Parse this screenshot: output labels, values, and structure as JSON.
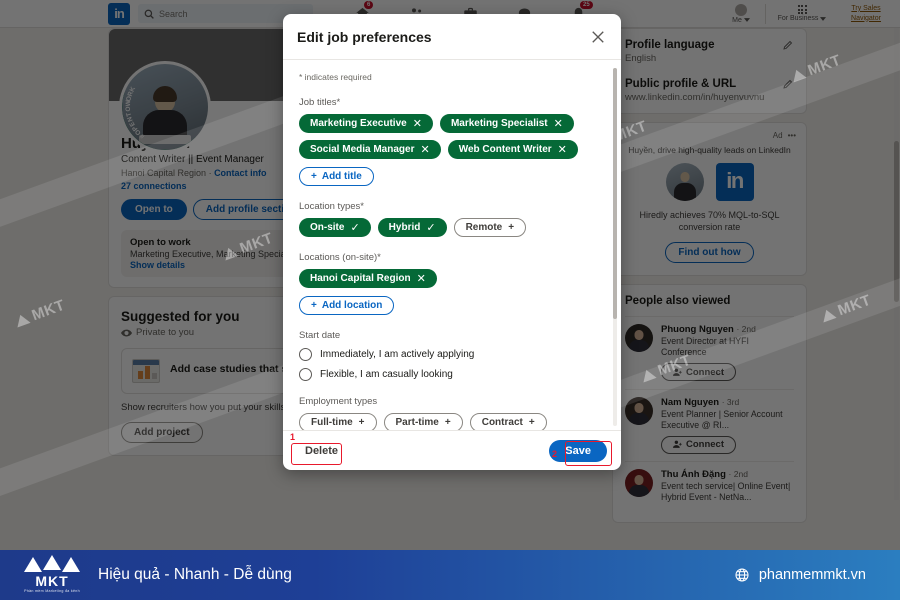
{
  "topnav": {
    "logo_text": "in",
    "search_placeholder": "Search",
    "items": [
      {
        "name": "home",
        "icon": "home-icon",
        "badge": "6"
      },
      {
        "name": "my-network",
        "icon": "people-icon",
        "badge": ""
      },
      {
        "name": "jobs",
        "icon": "briefcase-icon",
        "badge": ""
      },
      {
        "name": "messaging",
        "icon": "message-icon",
        "badge": ""
      },
      {
        "name": "notifications",
        "icon": "bell-icon",
        "badge": "25"
      }
    ],
    "me_label": "Me",
    "business_label": "For Business",
    "sales_nav_line1": "Try Sales",
    "sales_nav_line2": "Navigator"
  },
  "profile": {
    "name": "Huyền Vũ",
    "headline": "Content Writer || Event Manager",
    "location": "Hanoi Capital Region",
    "contact_info": "Contact info",
    "connections": "27 connections",
    "open_to_button": "Open to",
    "add_section_button": "Add profile section",
    "photo_frame_text": "#OPENTOWORK",
    "open_to_work": {
      "title": "Open to work",
      "subtitle": "Marketing Executive, Marketing Special...",
      "link": "Show details"
    }
  },
  "suggested": {
    "title": "Suggested for you",
    "private_label": "Private to you",
    "card_title": "Add case studies that sho",
    "card_desc": "Show recruiters how you put your skills to use by adding projects to your profile.",
    "card_button": "Add project"
  },
  "right_rail": {
    "profile_language": {
      "title": "Profile language",
      "value": "English"
    },
    "public_profile": {
      "title": "Public profile & URL",
      "value": "www.linkedin.com/in/huyenvuvnu"
    },
    "ad": {
      "label": "Ad",
      "more": "•••",
      "headline": "Huyền, drive high-quality leads on LinkedIn",
      "body": "Hiredly achieves 70% MQL-to-SQL conversion rate",
      "button": "Find out how",
      "brand_mark": "in"
    },
    "people_also_viewed": {
      "title": "People also viewed",
      "connect_label": "Connect",
      "people": [
        {
          "name": "Phuong Nguyen",
          "degree": "· 2nd",
          "desc": "Event Director at HYFI Conference",
          "avatar_color": "#2f2a26"
        },
        {
          "name": "Nam Nguyen",
          "degree": "· 3rd",
          "desc": "Event Planner | Senior Account Executive @ RI...",
          "avatar_color": "#3a2f28"
        },
        {
          "name": "Thu Ánh Đặng",
          "degree": "· 2nd",
          "desc": "Event tech service| Online Event| Hybrid Event - NetNa...",
          "avatar_color": "#7a1f22"
        }
      ]
    }
  },
  "modal": {
    "title": "Edit job preferences",
    "close_icon": "close-icon",
    "required_note": "* indicates required",
    "job_titles": {
      "label": "Job titles*",
      "chips": [
        "Marketing Executive",
        "Marketing Specialist",
        "Social Media Manager",
        "Web Content Writer"
      ],
      "add_button": "Add title"
    },
    "location_types": {
      "label": "Location types*",
      "selected": [
        "On-site",
        "Hybrid"
      ],
      "unselected": [
        "Remote"
      ]
    },
    "locations": {
      "label": "Locations (on-site)*",
      "chips": [
        "Hanoi Capital Region"
      ],
      "add_button": "Add location"
    },
    "start_date": {
      "label": "Start date",
      "options": [
        "Immediately, I am actively applying",
        "Flexible, I am casually looking"
      ]
    },
    "employment_types": {
      "label": "Employment types",
      "options": [
        "Full-time",
        "Part-time",
        "Contract"
      ]
    },
    "footer": {
      "delete_label": "Delete",
      "save_label": "Save",
      "delete_step": "1",
      "save_step": "2"
    }
  },
  "watermarks": {
    "text": "MKT",
    "instances": [
      "MKT",
      "MKT",
      "MKT",
      "MKT",
      "MKT",
      "MKT",
      "MKT"
    ]
  },
  "banner": {
    "logo_text": "MKT",
    "logo_sub": "Phần mềm Marketing đa kênh",
    "slogan": "Hiệu quả - Nhanh - Dễ dùng",
    "url": "phanmemmkt.vn",
    "globe_icon": "globe-icon"
  },
  "colors": {
    "linkedin_blue": "#0a66c2",
    "chip_green": "#056937",
    "annotation_red": "#e8192c",
    "banner_left": "#1e3a8a",
    "banner_right": "#2b7ec0"
  }
}
